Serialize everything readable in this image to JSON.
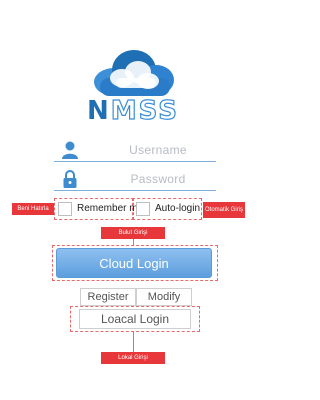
{
  "logo": {
    "brand_n": "N",
    "brand_rest": "MSS"
  },
  "login": {
    "username_placeholder": "Username",
    "password_placeholder": "Password",
    "remember_label": "Remember me",
    "autologin_label": "Auto-login",
    "cloud_login_label": "Cloud Login",
    "register_label": "Register",
    "modify_label": "Modify",
    "local_login_label": "Loacal Login"
  },
  "annotations": {
    "remember_tag": "Beni Hatırla",
    "autologin_tag": "Otomatik Giriş",
    "cloud_tag": "Bulut Girişi",
    "local_tag": "Lokal Girişi"
  },
  "colors": {
    "accent": "#5d9ede",
    "brand": "#1f6fb5",
    "callout": "#e8373a"
  },
  "icons": {
    "user": "user-icon",
    "password": "lock-icon",
    "logo": "cloud-logo-icon"
  }
}
